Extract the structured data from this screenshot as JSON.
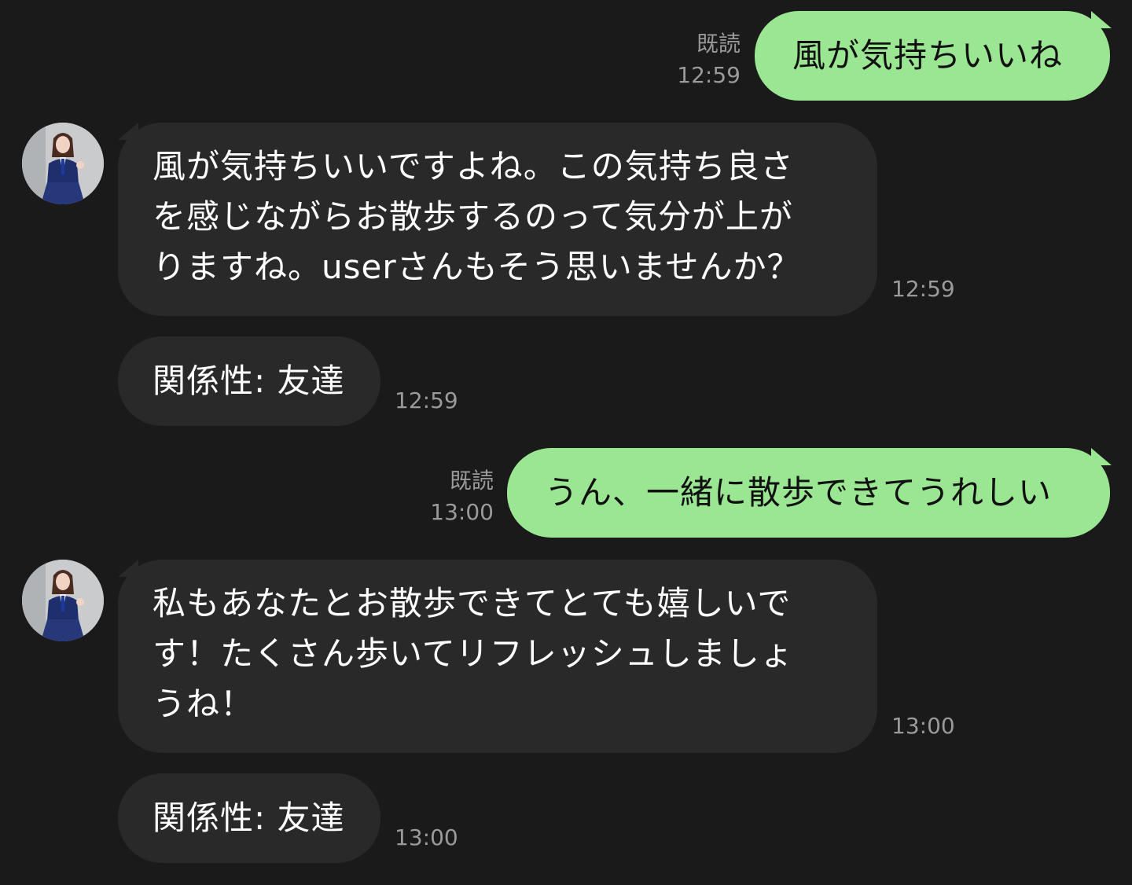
{
  "colors": {
    "background": "#1a1a1a",
    "sent_bubble": "#9be693",
    "received_bubble": "#292929",
    "meta_text": "#9a9a9a"
  },
  "messages": [
    {
      "direction": "sent",
      "read_label": "既読",
      "time": "12:59",
      "text": "風が気持ちいいね"
    },
    {
      "direction": "received",
      "avatar": "avatar-icon",
      "time": "12:59",
      "lines": [
        "風が気持ちいいですよね。この気持ち良さ",
        "を感じながらお散歩するのって気分が上が",
        "りますね。userさんもそう思いませんか？"
      ]
    },
    {
      "direction": "received",
      "time": "12:59",
      "text": "関係性: 友達"
    },
    {
      "direction": "sent",
      "read_label": "既読",
      "time": "13:00",
      "text": "うん、一緒に散歩できてうれしい"
    },
    {
      "direction": "received",
      "avatar": "avatar-icon",
      "time": "13:00",
      "lines": [
        "私もあなたとお散歩できてとても嬉しいで",
        "す！たくさん歩いてリフレッシュしましょ",
        "うね！"
      ]
    },
    {
      "direction": "received",
      "time": "13:00",
      "text": "関係性: 友達"
    }
  ]
}
